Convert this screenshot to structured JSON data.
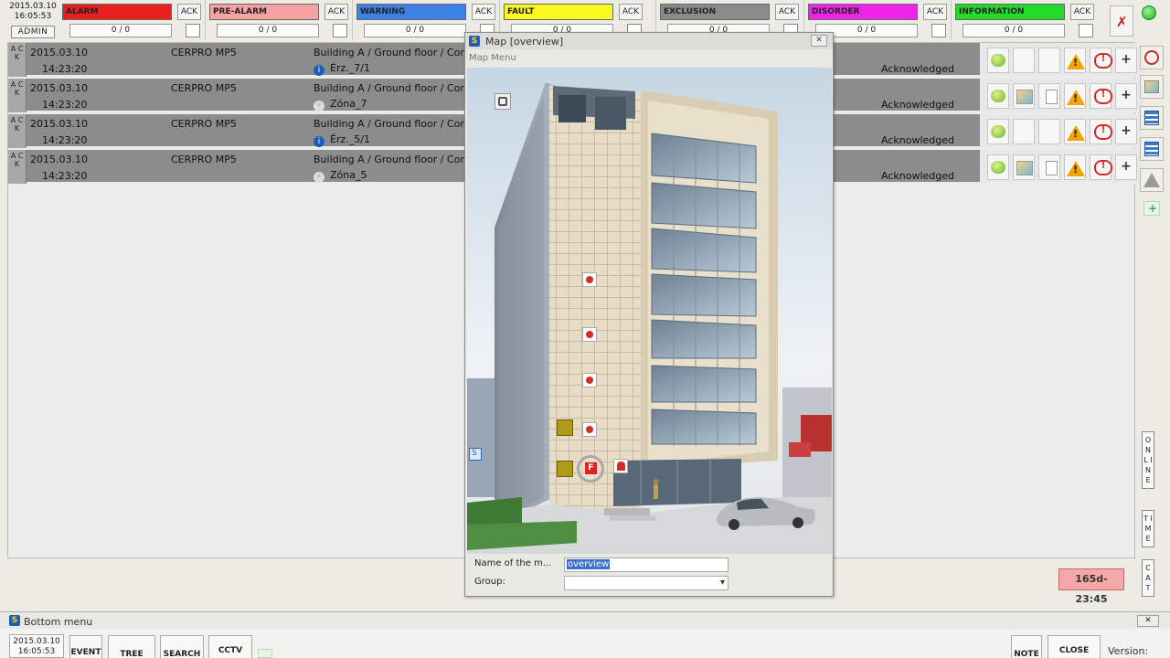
{
  "top": {
    "date": "2015.03.10",
    "time": "16:05:53",
    "user": "ADMIN"
  },
  "categories": [
    {
      "label": "ALARM",
      "color": "#e82020",
      "ack": "ACK",
      "count": "0 / 0"
    },
    {
      "label": "PRE-ALARM",
      "color": "#f7a3a3",
      "ack": "ACK",
      "count": "0 / 0"
    },
    {
      "label": "WARNING",
      "color": "#3c82e6",
      "ack": "ACK",
      "count": "0 / 0"
    },
    {
      "label": "FAULT",
      "color": "#fafa1e",
      "ack": "ACK",
      "count": "0 / 0"
    },
    {
      "label": "EXCLUSION",
      "color": "#8a8a8a",
      "ack": "ACK",
      "count": "0 / 0"
    },
    {
      "label": "DISORDER",
      "color": "#ee24e8",
      "ack": "ACK",
      "count": "0 / 0"
    },
    {
      "label": "INFORMATION",
      "color": "#22dc2a",
      "ack": "ACK",
      "count": "0 / 0"
    }
  ],
  "events": [
    {
      "ack": "A C K",
      "date": "2015.03.10",
      "time": "14:23:20",
      "device": "CERPRO MP5",
      "location": "Building A / Ground floor / Cor",
      "zone": "Érz._7/1",
      "zone_icon": "info",
      "status": "Acknowledged"
    },
    {
      "ack": "A C K",
      "date": "2015.03.10",
      "time": "14:23:20",
      "device": "CERPRO MP5",
      "location": "Building A / Ground floor / Cor",
      "zone": "Zóna_7",
      "zone_icon": "detector",
      "status": "Acknowledged"
    },
    {
      "ack": "A C K",
      "date": "2015.03.10",
      "time": "14:23:20",
      "device": "CERPRO MP5",
      "location": "Building A / Ground floor / Cor",
      "zone": "Érz._5/1",
      "zone_icon": "info",
      "status": "Acknowledged"
    },
    {
      "ack": "A C K",
      "date": "2015.03.10",
      "time": "14:23:20",
      "device": "CERPRO MP5",
      "location": "Building A / Ground floor / Cor",
      "zone": "Zóna_5",
      "zone_icon": "detector",
      "status": "Acknowledged"
    }
  ],
  "side_tabs": {
    "online": "O N L I N E",
    "time": "T I M E",
    "cat": "C A T"
  },
  "timer": "165d-23:45",
  "map_window": {
    "title": "Map [overview]",
    "menu": "Map Menu",
    "name_label": "Name of the m...",
    "name_value": "overview",
    "group_label": "Group:",
    "group_value": "",
    "fire_marker": "F"
  },
  "bottom_menu": {
    "title": "Bottom menu",
    "date": "2015.03.10",
    "time": "16:05:53",
    "event": "EVENT",
    "tree": "TREE",
    "search": "SEARCH",
    "cctv": "CCTV",
    "note": "NOTE",
    "close": "CLOSE",
    "version": "Version:"
  }
}
